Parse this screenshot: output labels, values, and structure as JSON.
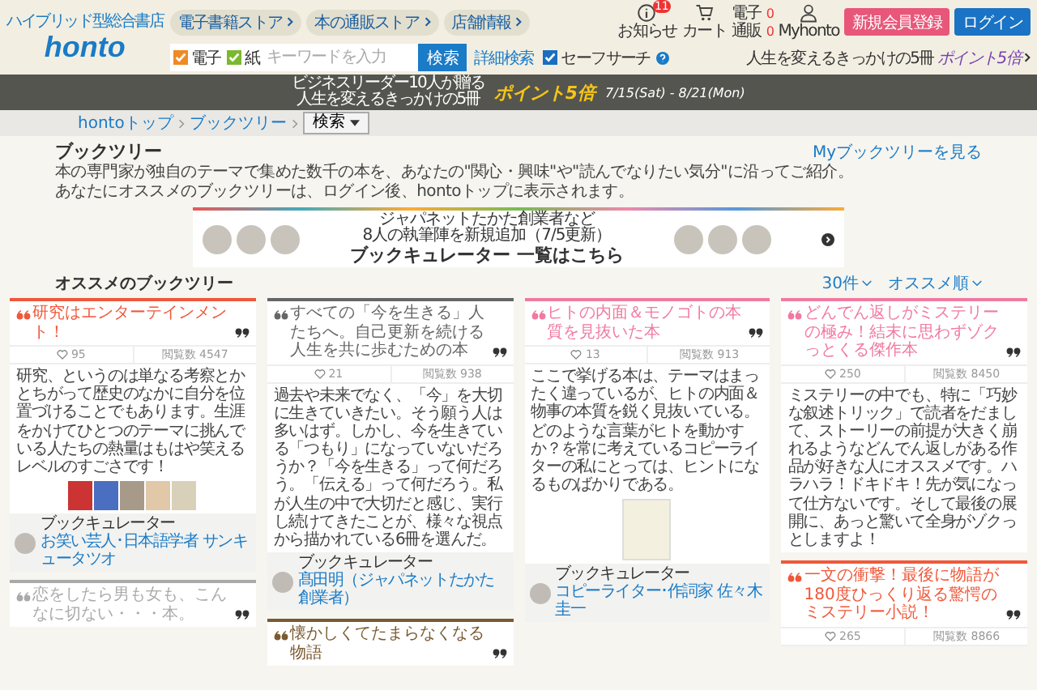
{
  "header": {
    "logo": {
      "tagline": "ハイブリッド型総合書店",
      "name": "honto"
    },
    "nav": [
      "電子書籍ストア",
      "本の通販ストア",
      "店舗情報"
    ],
    "notifications": {
      "count": "11",
      "label": "お知らせ"
    },
    "cart": {
      "label": "カート",
      "rows": [
        {
          "label": "電子",
          "count": "0"
        },
        {
          "label": "通販",
          "count": "0"
        }
      ]
    },
    "account": {
      "label": "Myhonto"
    },
    "buttons": [
      {
        "kind": "register",
        "label": "新規会員登録"
      },
      {
        "kind": "login",
        "label": "ログイン"
      }
    ],
    "search": {
      "filters": [
        {
          "label": "電子",
          "checked": true,
          "color": "#f08a24"
        },
        {
          "label": "紙",
          "checked": true,
          "color": "#7cb82f"
        }
      ],
      "placeholder": "キーワードを入力",
      "button": "検索",
      "advanced": "詳細検索",
      "safe_search": {
        "label": "セーフサーチ",
        "checked": true
      }
    },
    "promo": {
      "text": "人生を変えるきっかけの5冊",
      "points": "ポイント5倍"
    }
  },
  "promo_bar": {
    "lines": [
      "ビジネスリーダー10人が贈る",
      "人生を変えるきっかけの5冊"
    ],
    "points": "ポイント5倍",
    "period": "7/15(Sat) - 8/21(Mon)"
  },
  "breadcrumbs": {
    "items": [
      "hontoトップ",
      "ブックツリー"
    ],
    "dropdown": "検索"
  },
  "intro": {
    "title": "ブックツリー",
    "link": "Myブックツリーを見る",
    "lines": [
      "本の専門家が独自のテーマで集めた数千の本を、あなたの\"関心・興味\"や\"読んでなりたい気分\"に沿ってご紹介。",
      "あなたにオススメのブックツリーは、ログイン後、hontoトップに表示されます。"
    ]
  },
  "banner": {
    "lines": [
      "ジャパネットたかた創業者など",
      "8人の執筆陣を新規追加（7/5更新）"
    ],
    "headline": "ブックキュレーター 一覧はこちら"
  },
  "section": {
    "title": "オススメのブックツリー",
    "count": "30件",
    "sort": "オススメ順"
  },
  "card_columns": [
    {
      "cards": [
        {
          "kind": "book_strip",
          "title": "研究はエンターテインメント！",
          "color": "#f0583a",
          "likes": "95",
          "views": "閲覧数 4547",
          "description": "研究、というのは単なる考察とかとちがって歴史のなかに自分を位置づけることでもあります。生涯をかけてひとつのテーマに挑んでいる人たちの熱量はもはや笑えるレベルのすごさです！",
          "curator": {
            "label": "ブックキュレーター",
            "name": "お笑い芸人･日本語学者 サンキュータツオ"
          }
        },
        {
          "kind": "text",
          "title": "恋をしたら男も女も、こんなに切ない・・・本。",
          "color": "#aaaaaa"
        }
      ]
    },
    {
      "cards": [
        {
          "kind": "text",
          "title": "すべての「今を生きる」人たちへ。自己更新を続ける人生を共に歩むための本",
          "color": "#666666",
          "likes": "21",
          "views": "閲覧数 938",
          "description": "過去や未来でなく、「今」を大切に生きていきたい。そう願う人は多いはず。しかし、今を生きている「つもり」になっていないだろうか？「今を生きる」って何だろう。「伝える」って何だろう。私が人生の中で大切だと感じ、実行し続けてきたことが、様々な視点から描かれている6冊を選んだ。",
          "curator": {
            "label": "ブックキュレーター",
            "name": "髙田明（ジャパネットたかた創業者）"
          }
        },
        {
          "kind": "text",
          "title": "懐かしくてたまらなくなる物語",
          "color": "#7a5a30"
        }
      ]
    },
    {
      "cards": [
        {
          "kind": "single_book",
          "title": "ヒトの内面＆モノゴトの本質を見抜いた本",
          "color": "#f07aa0",
          "likes": "13",
          "views": "閲覧数 913",
          "description": "ここで挙げる本は、テーマはまったく違っているが、ヒトの内面＆物事の本質を鋭く見抜いている。どのような言葉がヒトを動かすか？を常に考えているコピーライターの私にとっては、ヒントになるものばかりである。",
          "curator": {
            "label": "ブックキュレーター",
            "name": "コピーライター･作詞家 佐々木圭一"
          }
        }
      ]
    },
    {
      "cards": [
        {
          "kind": "text",
          "title": "どんでん返しがミステリーの極み！結末に思わずゾクっとくる傑作本",
          "color": "#f07aa0",
          "likes": "250",
          "views": "閲覧数 8450",
          "description": "ミステリーの中でも、特に「巧妙な叙述トリック」で読者をだまして、ストーリーの前提が大きく崩れるようなどんでん返しがある作品が好きな人にオススメです。ハラハラ！ドキドキ！先が気になって仕方ないです。そして最後の展開に、あっと驚いて全身がゾクっとしますよ！"
        },
        {
          "kind": "text",
          "title": "一文の衝撃！最後に物語が180度ひっくり返る驚愕のミステリー小説！",
          "color": "#f0583a",
          "likes": "265",
          "views": "閲覧数 8866"
        }
      ]
    }
  ]
}
